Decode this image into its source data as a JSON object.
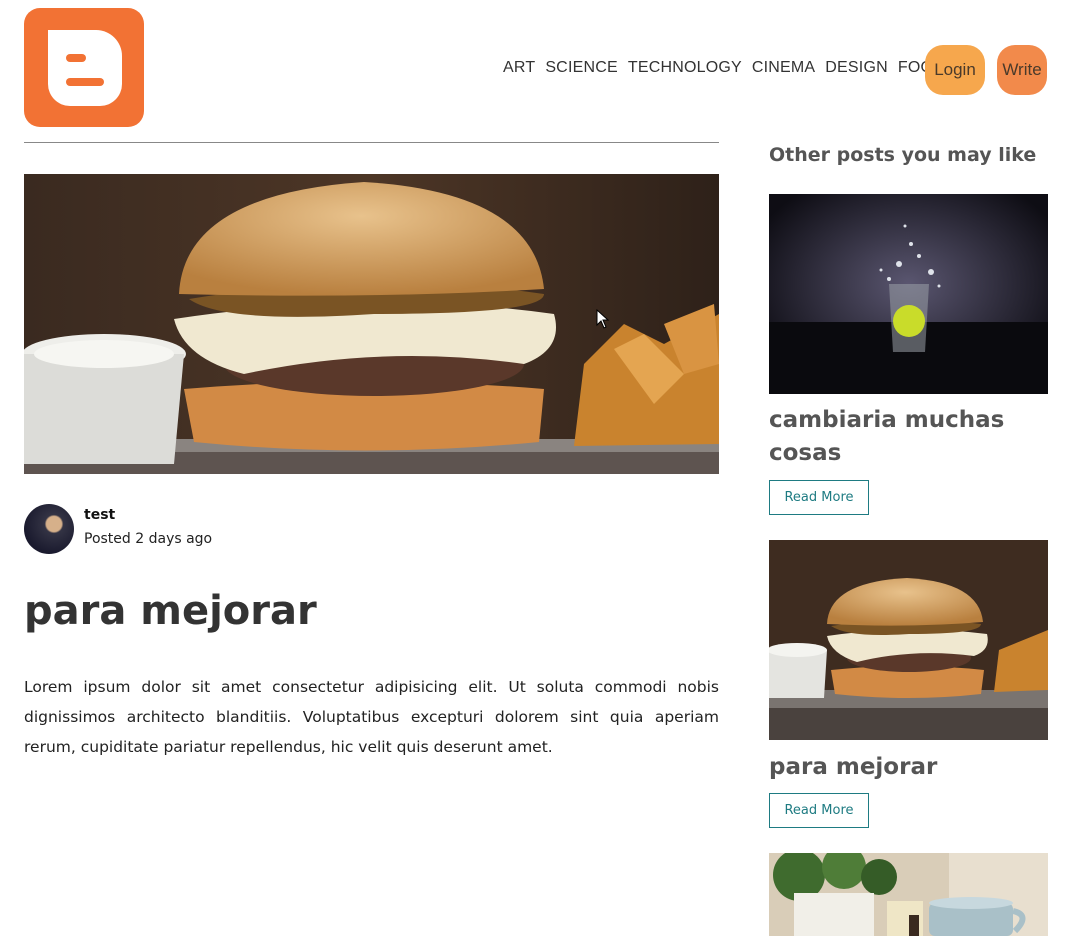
{
  "navbar": {
    "logo_icon": "blogger-logo",
    "links": [
      "ART",
      "SCIENCE",
      "TECHNOLOGY",
      "CINEMA",
      "DESIGN",
      "FOOD"
    ],
    "login_label": "Login",
    "write_label": "Write"
  },
  "post": {
    "image_icon": "burger-photo",
    "author_name": "test",
    "posted": "Posted 2 days ago",
    "title": "para mejorar",
    "body": "Lorem ipsum dolor sit amet consectetur adipisicing elit. Ut soluta commodi nobis dignissimos architecto blanditiis. Voluptatibus excepturi dolorem sint quia aperiam rerum, cupiditate pariatur repellendus, hic velit quis deserunt amet."
  },
  "sidebar": {
    "heading": "Other posts you may like",
    "cards": [
      {
        "image_icon": "splash-glass-photo",
        "title": "cambiaria muchas cosas",
        "read_more": "Read More"
      },
      {
        "image_icon": "burger-photo",
        "title": "para mejorar",
        "read_more": "Read More"
      },
      {
        "image_icon": "plant-mug-photo"
      }
    ]
  },
  "colors": {
    "logo": "#f27234",
    "login": "#f6a74d",
    "write": "#f28a4b",
    "accent": "#1e7b82"
  }
}
